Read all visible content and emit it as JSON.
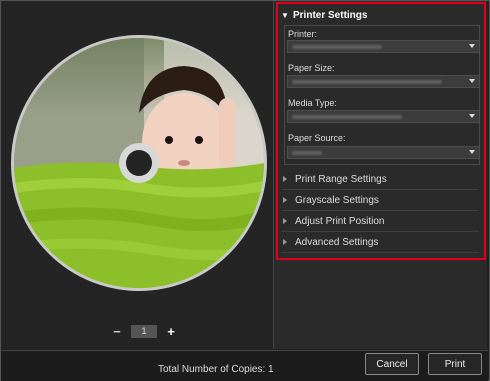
{
  "preview": {
    "zoom_minus": "−",
    "zoom_value": "1",
    "zoom_plus": "+"
  },
  "printer_settings": {
    "title": "Printer Settings",
    "printer_label": "Printer:",
    "paper_size_label": "Paper Size:",
    "media_type_label": "Media Type:",
    "paper_source_label": "Paper Source:"
  },
  "sections": [
    {
      "label": "Print Range Settings"
    },
    {
      "label": "Grayscale Settings"
    },
    {
      "label": "Adjust Print Position"
    },
    {
      "label": "Advanced Settings"
    }
  ],
  "footer": {
    "copies_text": "Total Number of Copies:  1",
    "cancel_label": "Cancel",
    "print_label": "Print"
  },
  "colors": {
    "highlight": "#e0001a",
    "disc_green": "#8dbf2a"
  }
}
